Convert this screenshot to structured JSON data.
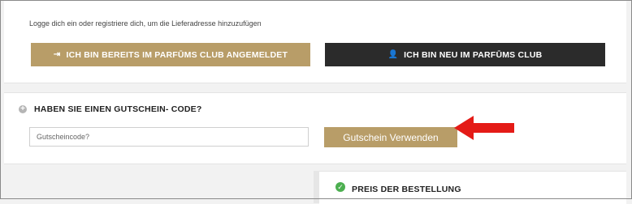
{
  "login": {
    "hint": "Logge dich ein oder registriere dich, um die Lieferadresse hinzuzufügen",
    "login_button": "ICH BIN BEREITS IM PARFŪMS CLUB ANGEMELDET",
    "register_button": "ICH BIN NEU IM PARFŪMS CLUB",
    "login_icon": "sign-in-icon",
    "register_icon": "add-user-icon"
  },
  "voucher": {
    "title": "HABEN SIE EINEN GUTSCHEIN- CODE?",
    "toggle_icon": "plus-circle-icon",
    "placeholder": "Gutscheincode?",
    "value": "",
    "apply_button": "Gutschein Verwenden"
  },
  "summary": {
    "title": "PREIS DER BESTELLUNG",
    "status_icon": "check-circle-icon"
  },
  "colors": {
    "accent": "#b89d68",
    "dark": "#2b2b2b",
    "arrow": "#e41b17",
    "success": "#4caf50"
  }
}
